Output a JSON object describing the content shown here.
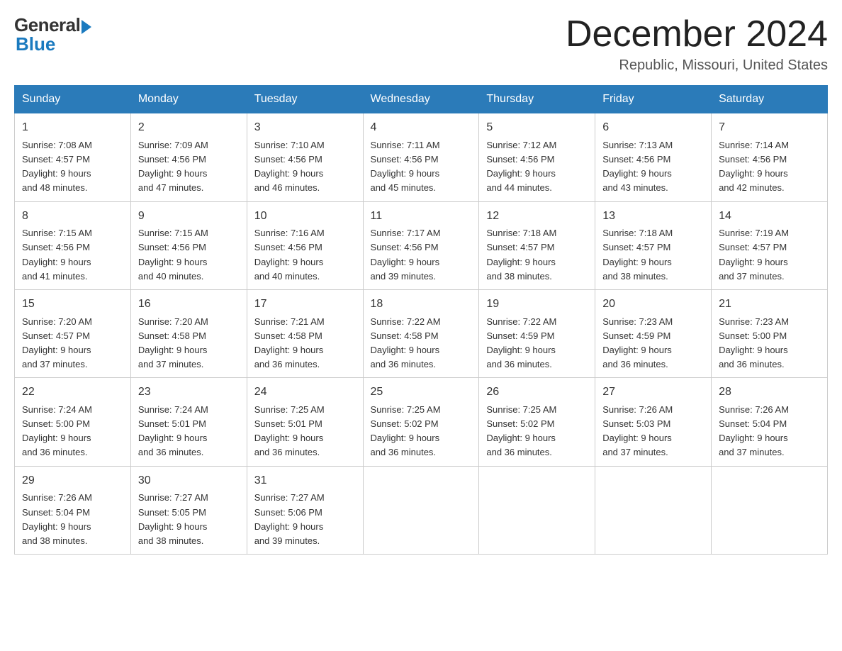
{
  "header": {
    "logo_general": "General",
    "logo_blue": "Blue",
    "month_title": "December 2024",
    "location": "Republic, Missouri, United States"
  },
  "weekdays": [
    "Sunday",
    "Monday",
    "Tuesday",
    "Wednesday",
    "Thursday",
    "Friday",
    "Saturday"
  ],
  "weeks": [
    [
      {
        "day": "1",
        "sunrise": "7:08 AM",
        "sunset": "4:57 PM",
        "daylight": "9 hours and 48 minutes."
      },
      {
        "day": "2",
        "sunrise": "7:09 AM",
        "sunset": "4:56 PM",
        "daylight": "9 hours and 47 minutes."
      },
      {
        "day": "3",
        "sunrise": "7:10 AM",
        "sunset": "4:56 PM",
        "daylight": "9 hours and 46 minutes."
      },
      {
        "day": "4",
        "sunrise": "7:11 AM",
        "sunset": "4:56 PM",
        "daylight": "9 hours and 45 minutes."
      },
      {
        "day": "5",
        "sunrise": "7:12 AM",
        "sunset": "4:56 PM",
        "daylight": "9 hours and 44 minutes."
      },
      {
        "day": "6",
        "sunrise": "7:13 AM",
        "sunset": "4:56 PM",
        "daylight": "9 hours and 43 minutes."
      },
      {
        "day": "7",
        "sunrise": "7:14 AM",
        "sunset": "4:56 PM",
        "daylight": "9 hours and 42 minutes."
      }
    ],
    [
      {
        "day": "8",
        "sunrise": "7:15 AM",
        "sunset": "4:56 PM",
        "daylight": "9 hours and 41 minutes."
      },
      {
        "day": "9",
        "sunrise": "7:15 AM",
        "sunset": "4:56 PM",
        "daylight": "9 hours and 40 minutes."
      },
      {
        "day": "10",
        "sunrise": "7:16 AM",
        "sunset": "4:56 PM",
        "daylight": "9 hours and 40 minutes."
      },
      {
        "day": "11",
        "sunrise": "7:17 AM",
        "sunset": "4:56 PM",
        "daylight": "9 hours and 39 minutes."
      },
      {
        "day": "12",
        "sunrise": "7:18 AM",
        "sunset": "4:57 PM",
        "daylight": "9 hours and 38 minutes."
      },
      {
        "day": "13",
        "sunrise": "7:18 AM",
        "sunset": "4:57 PM",
        "daylight": "9 hours and 38 minutes."
      },
      {
        "day": "14",
        "sunrise": "7:19 AM",
        "sunset": "4:57 PM",
        "daylight": "9 hours and 37 minutes."
      }
    ],
    [
      {
        "day": "15",
        "sunrise": "7:20 AM",
        "sunset": "4:57 PM",
        "daylight": "9 hours and 37 minutes."
      },
      {
        "day": "16",
        "sunrise": "7:20 AM",
        "sunset": "4:58 PM",
        "daylight": "9 hours and 37 minutes."
      },
      {
        "day": "17",
        "sunrise": "7:21 AM",
        "sunset": "4:58 PM",
        "daylight": "9 hours and 36 minutes."
      },
      {
        "day": "18",
        "sunrise": "7:22 AM",
        "sunset": "4:58 PM",
        "daylight": "9 hours and 36 minutes."
      },
      {
        "day": "19",
        "sunrise": "7:22 AM",
        "sunset": "4:59 PM",
        "daylight": "9 hours and 36 minutes."
      },
      {
        "day": "20",
        "sunrise": "7:23 AM",
        "sunset": "4:59 PM",
        "daylight": "9 hours and 36 minutes."
      },
      {
        "day": "21",
        "sunrise": "7:23 AM",
        "sunset": "5:00 PM",
        "daylight": "9 hours and 36 minutes."
      }
    ],
    [
      {
        "day": "22",
        "sunrise": "7:24 AM",
        "sunset": "5:00 PM",
        "daylight": "9 hours and 36 minutes."
      },
      {
        "day": "23",
        "sunrise": "7:24 AM",
        "sunset": "5:01 PM",
        "daylight": "9 hours and 36 minutes."
      },
      {
        "day": "24",
        "sunrise": "7:25 AM",
        "sunset": "5:01 PM",
        "daylight": "9 hours and 36 minutes."
      },
      {
        "day": "25",
        "sunrise": "7:25 AM",
        "sunset": "5:02 PM",
        "daylight": "9 hours and 36 minutes."
      },
      {
        "day": "26",
        "sunrise": "7:25 AM",
        "sunset": "5:02 PM",
        "daylight": "9 hours and 36 minutes."
      },
      {
        "day": "27",
        "sunrise": "7:26 AM",
        "sunset": "5:03 PM",
        "daylight": "9 hours and 37 minutes."
      },
      {
        "day": "28",
        "sunrise": "7:26 AM",
        "sunset": "5:04 PM",
        "daylight": "9 hours and 37 minutes."
      }
    ],
    [
      {
        "day": "29",
        "sunrise": "7:26 AM",
        "sunset": "5:04 PM",
        "daylight": "9 hours and 38 minutes."
      },
      {
        "day": "30",
        "sunrise": "7:27 AM",
        "sunset": "5:05 PM",
        "daylight": "9 hours and 38 minutes."
      },
      {
        "day": "31",
        "sunrise": "7:27 AM",
        "sunset": "5:06 PM",
        "daylight": "9 hours and 39 minutes."
      },
      null,
      null,
      null,
      null
    ]
  ],
  "labels": {
    "sunrise": "Sunrise:",
    "sunset": "Sunset:",
    "daylight": "Daylight:"
  }
}
